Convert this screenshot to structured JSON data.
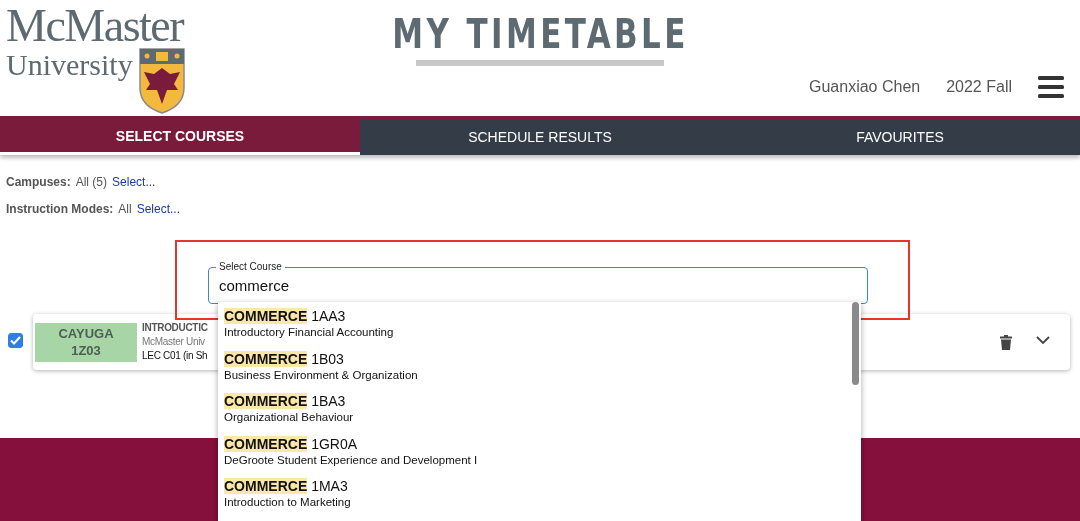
{
  "logo": {
    "line_1": "McMaster",
    "line_2": "University"
  },
  "title": "MY TIMETABLE",
  "user": {
    "name": "Guanxiao Chen",
    "term": "2022 Fall"
  },
  "tabs": [
    {
      "label": "SELECT COURSES",
      "selected": true
    },
    {
      "label": "SCHEDULE RESULTS",
      "selected": false
    },
    {
      "label": "FAVOURITES",
      "selected": false
    }
  ],
  "filters": [
    {
      "label": "Campuses:",
      "value": "All (5)",
      "link": "Select..."
    },
    {
      "label": "Instruction Modes:",
      "value": "All",
      "link": "Select..."
    }
  ],
  "course_field": {
    "label": "Select Course",
    "value": "commerce"
  },
  "course_card": {
    "checked": true,
    "campus": "CAYUGA",
    "code": "1Z03",
    "title": "INTRODUCTIC",
    "subtitle": "McMaster Univ",
    "section": "LEC C01 (in Sh"
  },
  "suggestions": [
    {
      "match": "COMMERCE",
      "code": "1AA3",
      "name": "Introductory Financial Accounting"
    },
    {
      "match": "COMMERCE",
      "code": "1B03",
      "name": "Business Environment & Organization"
    },
    {
      "match": "COMMERCE",
      "code": "1BA3",
      "name": "Organizational Behaviour"
    },
    {
      "match": "COMMERCE",
      "code": "1GR0A",
      "name": "DeGroote Student Experience and Development I"
    },
    {
      "match": "COMMERCE",
      "code": "1MA3",
      "name": "Introduction to Marketing"
    }
  ]
}
